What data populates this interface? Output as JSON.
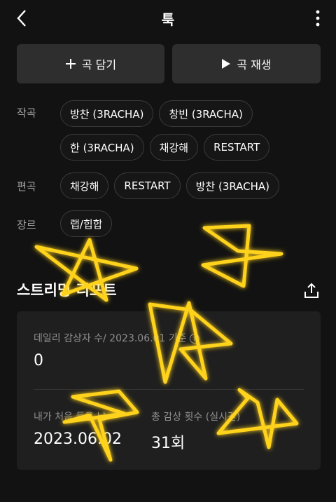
{
  "header": {
    "title": "툭"
  },
  "actions": {
    "add_label": "곡 담기",
    "play_label": "곡 재생"
  },
  "credits": [
    {
      "label": "작곡",
      "chips": [
        "방찬 (3RACHA)",
        "창빈 (3RACHA)",
        "한 (3RACHA)",
        "채강해",
        "RESTART"
      ]
    },
    {
      "label": "편곡",
      "chips": [
        "채강해",
        "RESTART",
        "방찬 (3RACHA)"
      ]
    },
    {
      "label": "장르",
      "chips": [
        "랩/힙합"
      ]
    }
  ],
  "report": {
    "title": "스트리밍 리포트",
    "daily_label": "데일리 감상자 수/ 2023.06.01 기준",
    "daily_value": "0",
    "first_label": "내가 처음 들은 날",
    "first_value": "2023.06.02",
    "total_label": "총 감상 횟수 (실시간)",
    "total_value": "31회"
  },
  "colors": {
    "background": "#121212",
    "button": "#2e2e2e",
    "card": "#1f1f1f",
    "doodle": "#ffd21e"
  },
  "icons": [
    "back-chevron-icon",
    "more-vertical-icon",
    "plus-icon",
    "play-icon",
    "share-icon",
    "info-icon",
    "star-doodle"
  ]
}
